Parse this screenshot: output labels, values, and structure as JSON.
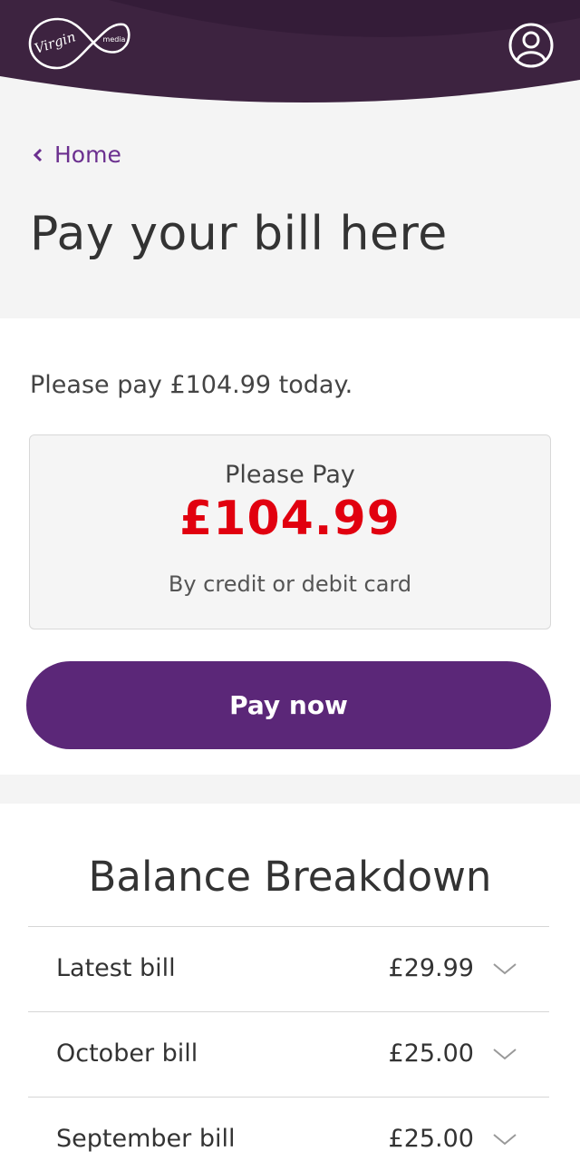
{
  "header": {
    "logo_text": "Virgin media",
    "logo_icon": "virgin-media-logo",
    "account_icon": "user-account-icon",
    "colors": {
      "background": "#3d2340",
      "background_dark": "#2d1831"
    }
  },
  "nav": {
    "back_label": "Home",
    "back_icon": "chevron-left-icon"
  },
  "page": {
    "title": "Pay your bill here"
  },
  "payment": {
    "intro": "Please pay £104.99 today.",
    "card_title": "Please Pay",
    "amount": "£104.99",
    "method": "By credit or debit card",
    "button_label": "Pay now",
    "colors": {
      "amount": "#e1000f",
      "button": "#5b2778"
    }
  },
  "balance": {
    "title": "Balance Breakdown",
    "items": [
      {
        "label": "Latest bill",
        "amount": "£29.99",
        "icon": "chevron-down-icon"
      },
      {
        "label": "October bill",
        "amount": "£25.00",
        "icon": "chevron-down-icon"
      },
      {
        "label": "September bill",
        "amount": "£25.00",
        "icon": "chevron-down-icon"
      }
    ]
  }
}
